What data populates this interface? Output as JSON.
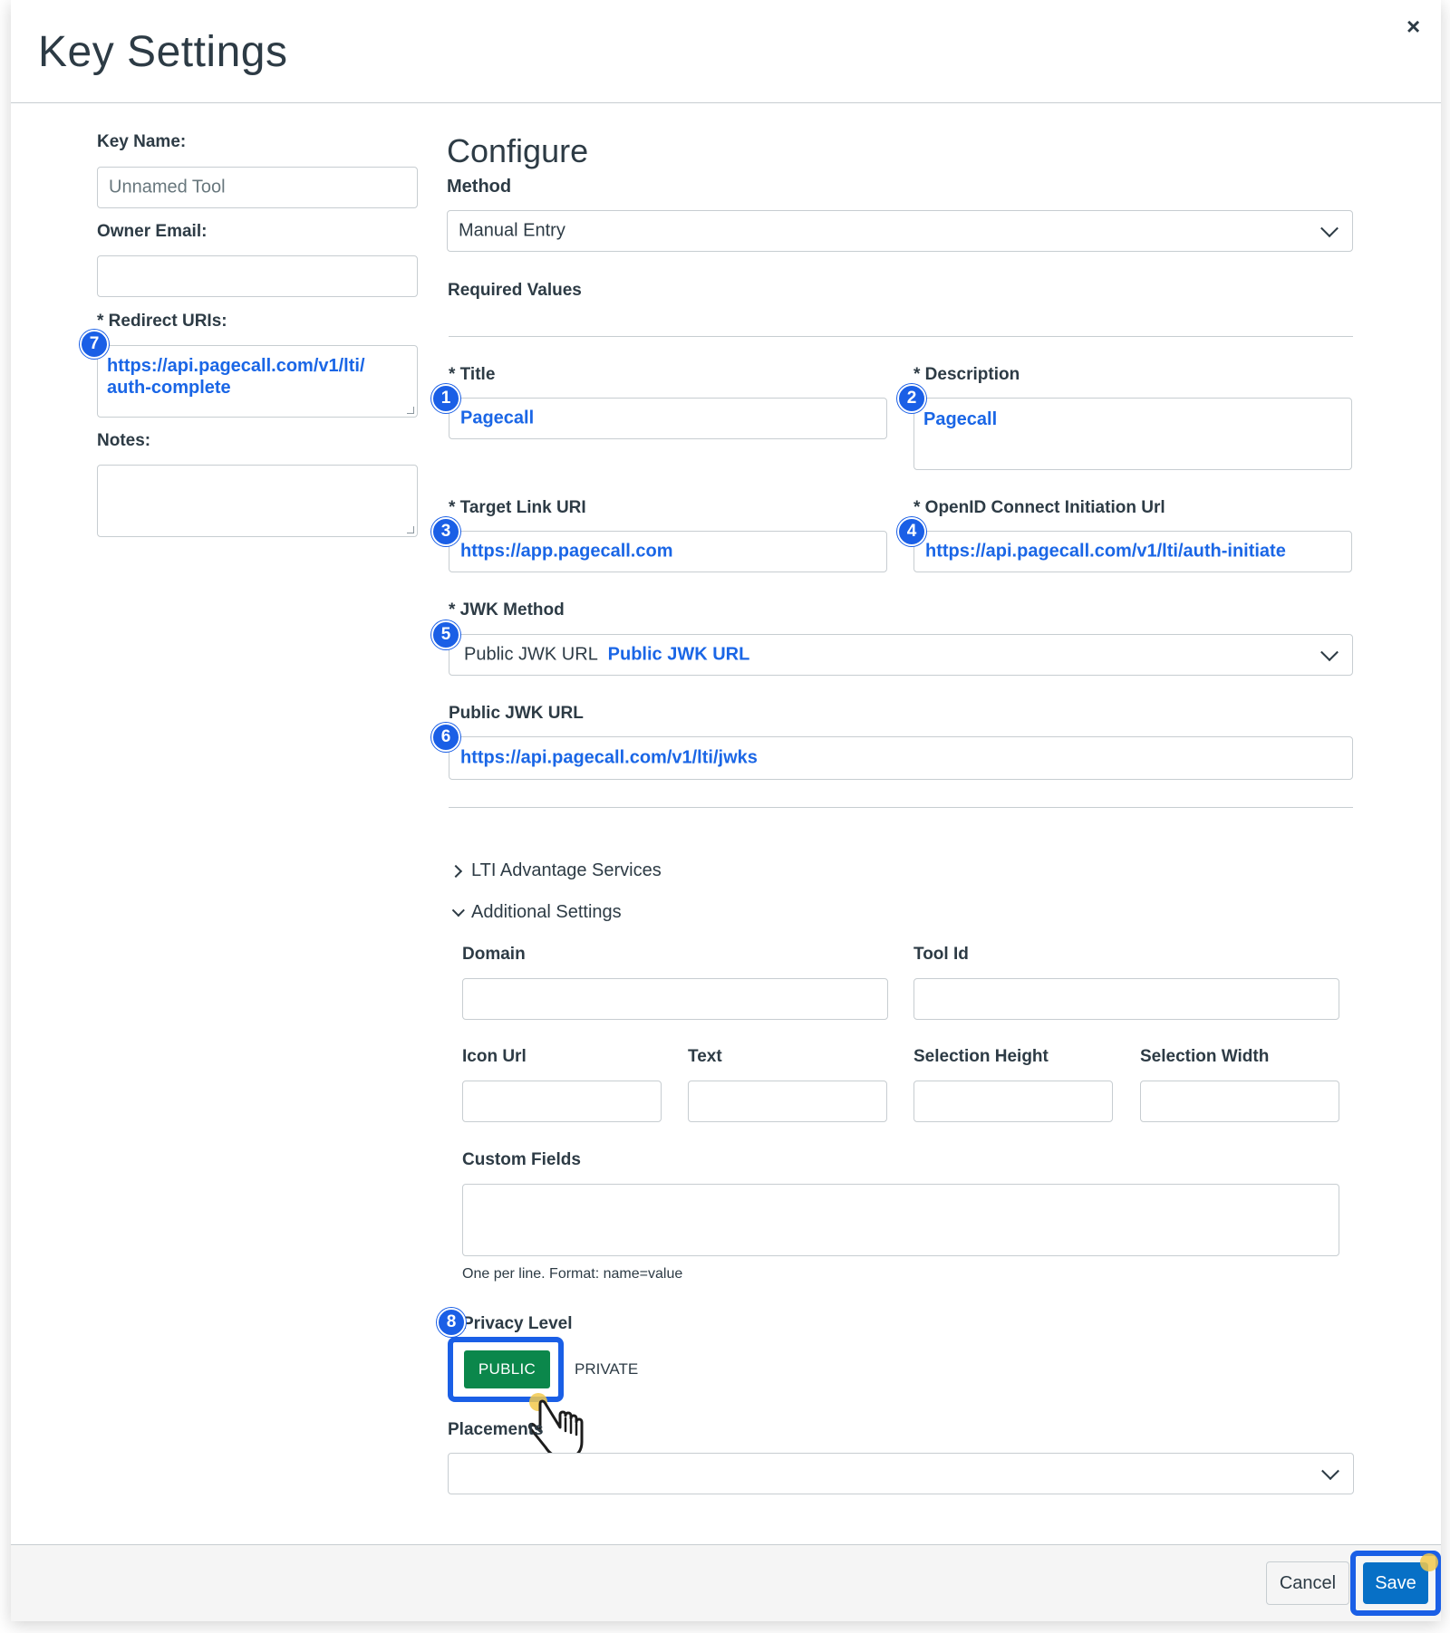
{
  "header": {
    "title": "Key Settings",
    "close_icon": "×"
  },
  "left": {
    "key_name_label": "Key Name:",
    "key_name_placeholder": "Unnamed Tool",
    "owner_email_label": "Owner Email:",
    "owner_email_value": "",
    "redirect_label": "* Redirect URIs:",
    "redirect_value_line1": "https://api.pagecall.com/v1/lti/",
    "redirect_value_line2": "auth-complete",
    "notes_label": "Notes:",
    "notes_value": ""
  },
  "configure": {
    "heading": "Configure",
    "method_label": "Method",
    "method_value": "Manual Entry",
    "required_values_label": "Required Values",
    "title_label": "* Title",
    "title_value": "Pagecall",
    "description_label": "* Description",
    "description_value": "Pagecall",
    "target_link_label": "* Target Link URI",
    "target_link_value": "https://app.pagecall.com",
    "openid_label": "* OpenID Connect Initiation Url",
    "openid_value": "https://api.pagecall.com/v1/lti/auth-initiate",
    "jwk_method_label": "* JWK Method",
    "jwk_method_value": "Public JWK URL",
    "jwk_method_annotation": "Public JWK URL",
    "public_jwk_label": "Public JWK URL",
    "public_jwk_value": "https://api.pagecall.com/v1/lti/jwks"
  },
  "sections": {
    "lti_advantage": "LTI Advantage Services",
    "additional": "Additional Settings"
  },
  "additional": {
    "domain_label": "Domain",
    "tool_id_label": "Tool Id",
    "icon_url_label": "Icon Url",
    "text_label": "Text",
    "selection_height_label": "Selection Height",
    "selection_width_label": "Selection Width",
    "custom_fields_label": "Custom Fields",
    "custom_fields_hint": "One per line. Format: name=value",
    "privacy_label": "Privacy Level",
    "privacy_public": "PUBLIC",
    "privacy_private": "PRIVATE",
    "placements_label": "Placements",
    "placements_value": ""
  },
  "badges": [
    "1",
    "2",
    "3",
    "4",
    "5",
    "6",
    "7",
    "8"
  ],
  "footer": {
    "cancel_label": "Cancel",
    "save_label": "Save"
  },
  "colors": {
    "accent": "#1a5fe6",
    "link_blue": "#1a66e6",
    "public_green": "#0b874b",
    "save_blue": "#0770c6"
  },
  "icons": [
    "close-icon",
    "chevron-down-icon",
    "chevron-right-icon",
    "pointer-hand-icon"
  ]
}
